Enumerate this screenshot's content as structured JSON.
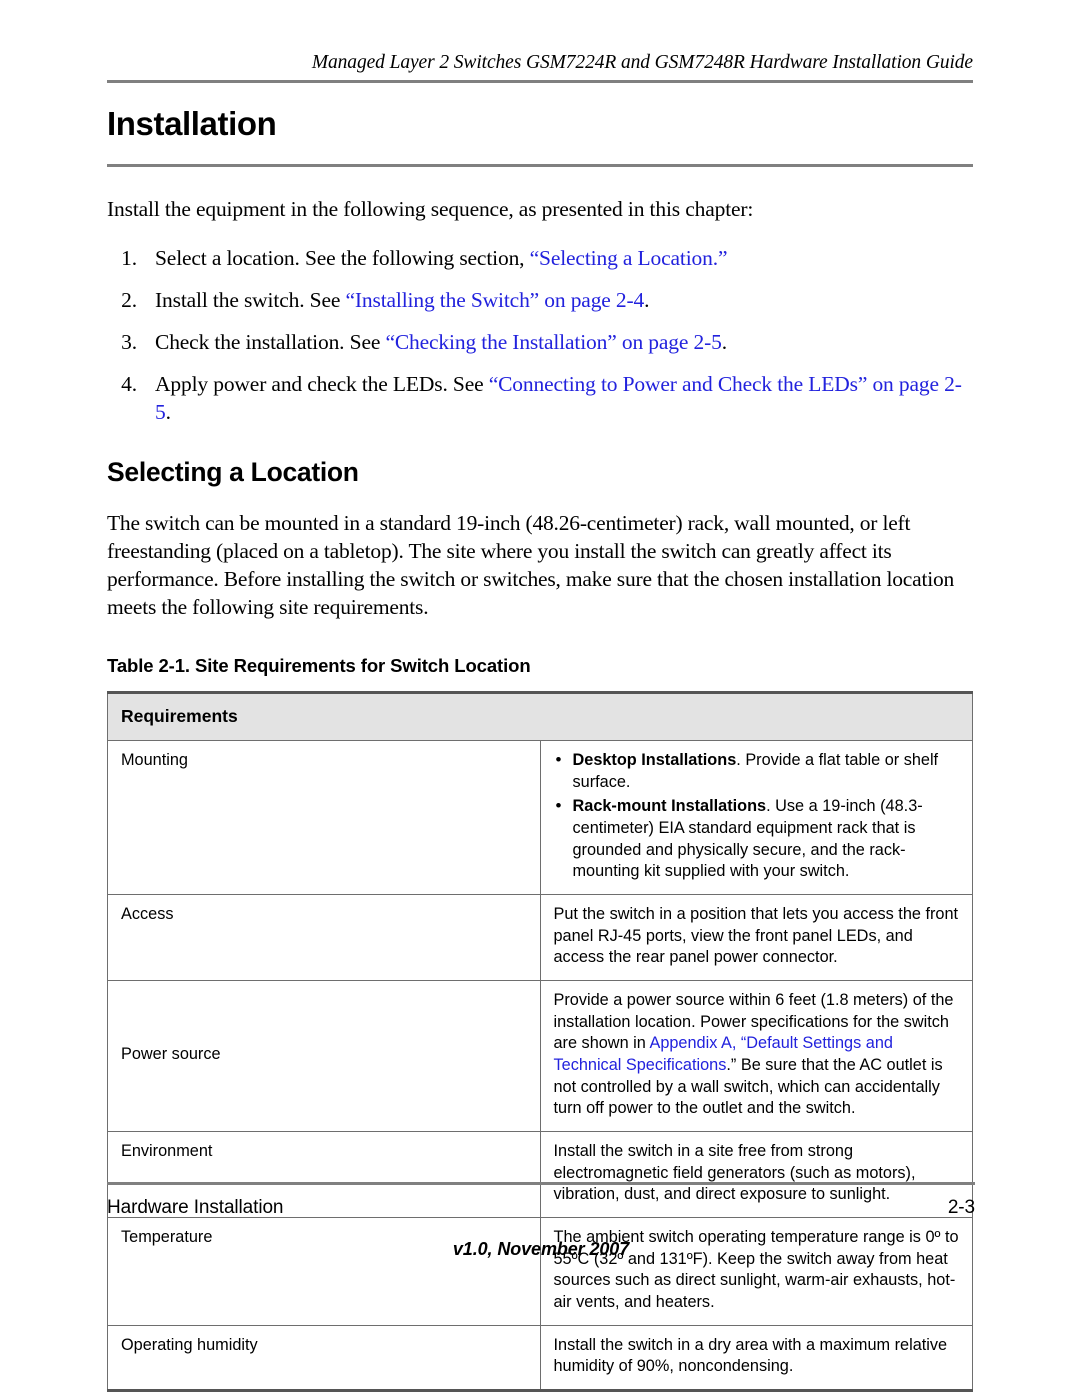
{
  "header": {
    "running_title": "Managed Layer 2 Switches GSM7224R and GSM7248R Hardware Installation Guide"
  },
  "chapter": {
    "title": "Installation",
    "intro": "Install the equipment in the following sequence, as presented in this chapter:",
    "steps": [
      {
        "number": "1.",
        "text_before": "Select a location. See the following section, ",
        "link": "“Selecting a Location.”",
        "text_after": ""
      },
      {
        "number": "2.",
        "text_before": "Install the switch. See ",
        "link": "“Installing the Switch” on page 2-4",
        "text_after": "."
      },
      {
        "number": "3.",
        "text_before": "Check the installation. See ",
        "link": "“Checking the Installation” on page 2-5",
        "text_after": "."
      },
      {
        "number": "4.",
        "text_before": "Apply power and check the LEDs. See ",
        "link": "“Connecting to Power and Check the LEDs” on page 2-5",
        "text_after": "."
      }
    ]
  },
  "section": {
    "heading": "Selecting a Location",
    "paragraph": "The switch can be mounted in a standard 19-inch (48.26-centimeter) rack, wall mounted, or left freestanding (placed on a tabletop). The site where you install the switch can greatly affect its performance. Before installing the switch or switches, make sure that the chosen installation location meets the following site requirements."
  },
  "table": {
    "caption": "Table 2-1.  Site Requirements for Switch Location",
    "header": "Requirements",
    "rows": [
      {
        "label": "Mounting",
        "bullets": [
          {
            "bold": "Desktop Installations",
            "rest": ". Provide a flat table or shelf surface."
          },
          {
            "bold": "Rack-mount Installations",
            "rest": ". Use a 19-inch (48.3-centimeter) EIA standard equipment rack that is grounded and physically secure, and the rack-mounting kit supplied with your switch."
          }
        ]
      },
      {
        "label": "Access",
        "text": "Put the switch in a position that lets you access the front panel RJ-45 ports, view the front panel LEDs, and access the rear panel power connector."
      },
      {
        "label": "Power source",
        "text_before": "Provide a power source within 6 feet (1.8 meters) of the installation location. Power specifications for the switch are shown in ",
        "link": "Appendix A, “Default Settings and Technical Specifications",
        "text_after": ".” Be sure that the AC outlet is not controlled by a wall switch, which can accidentally turn off power to the outlet and the switch."
      },
      {
        "label": "Environment",
        "text": "Install the switch in a site free from strong electromagnetic field generators (such as motors), vibration, dust, and direct exposure to sunlight."
      },
      {
        "label": "Temperature",
        "text": "The ambient switch operating temperature range is 0º to 55ºC (32º and 131ºF). Keep the switch away from heat sources such as direct sunlight, warm-air exhausts, hot-air vents, and heaters."
      },
      {
        "label": "Operating humidity",
        "text": "Install the switch in a dry area with a maximum relative humidity of 90%, noncondensing."
      }
    ]
  },
  "footer": {
    "left": "Hardware Installation",
    "right": "2-3",
    "version": "v1.0, November 2007"
  },
  "colors": {
    "link": "#2222dd",
    "rule": "#808080",
    "table_header_bg": "#e3e3e3",
    "table_border": "#6e6e6e"
  }
}
